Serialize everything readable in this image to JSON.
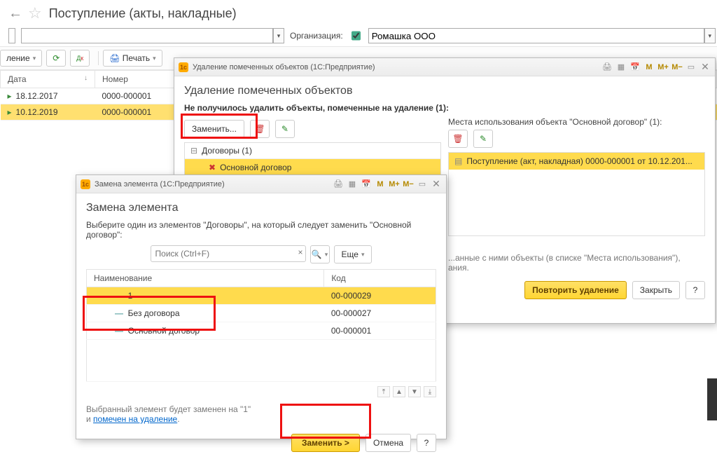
{
  "page": {
    "title": "Поступление (акты, накладные)",
    "org_label": "Организация:",
    "org_value": "Ромашка ООО"
  },
  "toolbar": {
    "action_label": "ление",
    "print_label": "Печать"
  },
  "table": {
    "col_date": "Дата",
    "col_num": "Номер",
    "rows": [
      {
        "date": "18.12.2017",
        "num": "0000-000001",
        "sel": false
      },
      {
        "date": "10.12.2019",
        "num": "0000-000001",
        "sel": true
      }
    ]
  },
  "delete_dlg": {
    "frame": "Удаление помеченных объектов  (1С:Предприятие)",
    "title": "Удаление помеченных объектов",
    "subtitle": "Не получилось удалить объекты, помеченные на удаление (1):",
    "replace_btn": "Заменить...",
    "tree_group": "Договоры (1)",
    "tree_item": "Основной договор",
    "places_label": "Места использования объекта \"Основной договор\" (1):",
    "usage_item": "Поступление (акт, накладная) 0000-000001 от 10.12.201...",
    "note1": "...анные с ними объекты (в списке \"Места использования\"),",
    "note2": "ания.",
    "repeat_btn": "Повторить удаление",
    "close_btn": "Закрыть",
    "help_btn": "?"
  },
  "replace_dlg": {
    "frame": "Замена элемента  (1С:Предприятие)",
    "title": "Замена элемента",
    "instruction": "Выберите один из элементов \"Договоры\", на который следует заменить \"Основной договор\":",
    "search_placeholder": "Поиск (Ctrl+F)",
    "more_btn": "Еще",
    "col_name": "Наименование",
    "col_code": "Код",
    "rows": [
      {
        "name": "1",
        "code": "00-000029",
        "sel": true
      },
      {
        "name": "Без договора",
        "code": "00-000027",
        "sel": false
      },
      {
        "name": "Основной договор",
        "code": "00-000001",
        "sel": false
      }
    ],
    "note_prefix": "Выбранный элемент будет заменен на \"1\"",
    "note_link_prefix": "и ",
    "note_link": "помечен на удаление",
    "note_link_suffix": ".",
    "go_btn": "Заменить >",
    "cancel_btn": "Отмена",
    "help_btn": "?"
  },
  "mmm": {
    "m": "M",
    "mp": "M+",
    "mm": "M−"
  }
}
